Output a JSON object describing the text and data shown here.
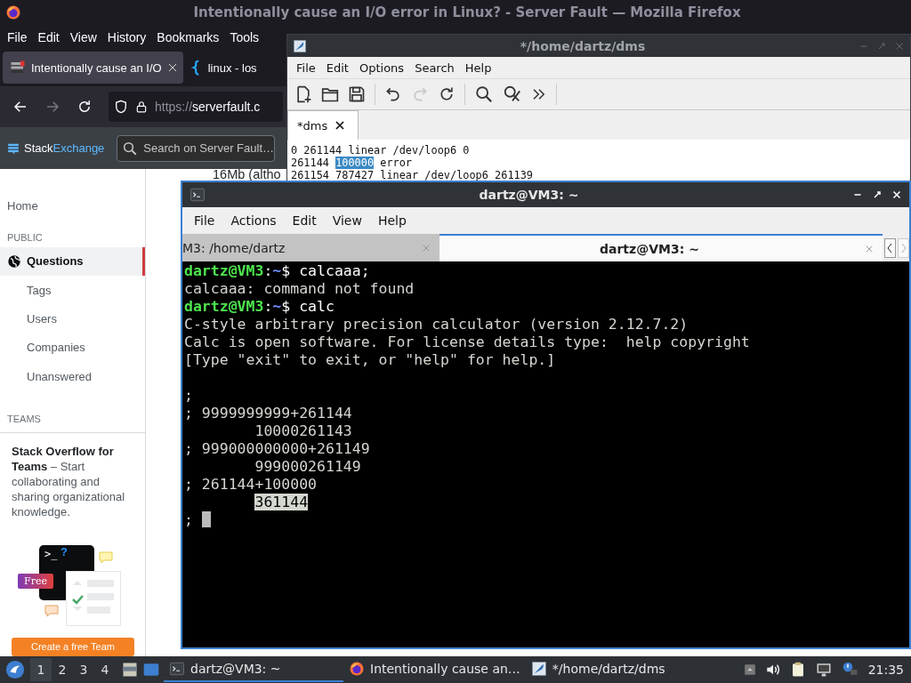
{
  "firefox": {
    "title": "Intentionally cause an I/O error in Linux? - Server Fault — Mozilla Firefox",
    "menu": [
      "File",
      "Edit",
      "View",
      "History",
      "Bookmarks",
      "Tools"
    ],
    "tabs": [
      {
        "label": "Intentionally cause an I/O",
        "selected": true
      },
      {
        "label": "linux - los",
        "selected": false
      }
    ],
    "url": {
      "scheme": "https://",
      "host": "serverfault.c"
    },
    "brand": {
      "first": "Stack",
      "second": "Exchange"
    },
    "search": {
      "placeholder": "Search on Server Fault…"
    },
    "sidebar": {
      "home": "Home",
      "public_heading": "PUBLIC",
      "items": [
        {
          "label": "Questions",
          "selected": true
        },
        {
          "label": "Tags",
          "selected": false
        },
        {
          "label": "Users",
          "selected": false
        },
        {
          "label": "Companies",
          "selected": false
        },
        {
          "label": "Unanswered",
          "selected": false
        }
      ],
      "teams_heading": "TEAMS",
      "promo": "**Stack Overflow for Teams** – Start collaborating and sharing organizational knowledge.",
      "prompt_glyph": ">_",
      "question_glyph": "?",
      "free_badge": "Free",
      "cta": "Create a free Team"
    },
    "body_text": "16Mb (altho"
  },
  "editor": {
    "title": "*/home/dartz/dms",
    "menu": [
      "File",
      "Edit",
      "Options",
      "Search",
      "Help"
    ],
    "tab": "*dms",
    "lines": [
      [
        {
          "text": "0 261144 linear /dev/loop6 0",
          "selected": false
        }
      ],
      [
        {
          "text": "261144 ",
          "selected": false
        },
        {
          "text": "100000",
          "selected": true
        },
        {
          "text": " error",
          "selected": false
        }
      ],
      [
        {
          "text": "261154 787427 linear /dev/loop6 261139",
          "selected": false
        }
      ]
    ]
  },
  "terminal": {
    "title": "dartz@VM3: ~",
    "menu": [
      "File",
      "Actions",
      "Edit",
      "View",
      "Help"
    ],
    "tabs": [
      {
        "label": "M3: /home/dartz",
        "selected": false
      },
      {
        "label": "dartz@VM3: ~",
        "selected": true
      }
    ],
    "lines": [
      {
        "kind": "prompt",
        "user": "dartz@VM3",
        "separator": ":",
        "path": "~",
        "symbol": "$",
        "command": "calcaaa;"
      },
      {
        "kind": "output",
        "text": "calcaaa: command not found",
        "selected": false
      },
      {
        "kind": "prompt",
        "user": "dartz@VM3",
        "separator": ":",
        "path": "~",
        "symbol": "$",
        "command": "calc"
      },
      {
        "kind": "output",
        "text": "C-style arbitrary precision calculator (version 2.12.7.2)",
        "selected": false
      },
      {
        "kind": "output",
        "text": "Calc is open software. For license details type:  help copyright",
        "selected": false
      },
      {
        "kind": "output",
        "text": "[Type \"exit\" to exit, or \"help\" for help.]",
        "selected": false
      },
      {
        "kind": "blank"
      },
      {
        "kind": "output",
        "text": ";",
        "selected": false
      },
      {
        "kind": "output",
        "text": "; 9999999999+261144",
        "selected": false
      },
      {
        "kind": "output",
        "text": "        10000261143",
        "selected": false
      },
      {
        "kind": "output",
        "text": "; 999000000000+261149",
        "selected": false
      },
      {
        "kind": "output",
        "text": "        999000261149",
        "selected": false
      },
      {
        "kind": "output",
        "text": "; 261144+100000",
        "selected": false
      },
      {
        "kind": "output",
        "text": "        361144",
        "selected": true
      },
      {
        "kind": "input",
        "text": ";",
        "cursor": true
      }
    ]
  },
  "taskbar": {
    "workspaces": [
      {
        "label": "1",
        "selected": true
      },
      {
        "label": "2",
        "selected": false
      },
      {
        "label": "3",
        "selected": false
      },
      {
        "label": "4",
        "selected": false
      }
    ],
    "tasks": [
      {
        "kind": "terminal",
        "label": "dartz@VM3: ~",
        "selected": true
      },
      {
        "kind": "browser",
        "label": "Intentionally cause an…",
        "selected": false
      },
      {
        "kind": "editor",
        "label": "*/home/dartz/dms",
        "selected": false
      }
    ],
    "clock": "21:35"
  }
}
